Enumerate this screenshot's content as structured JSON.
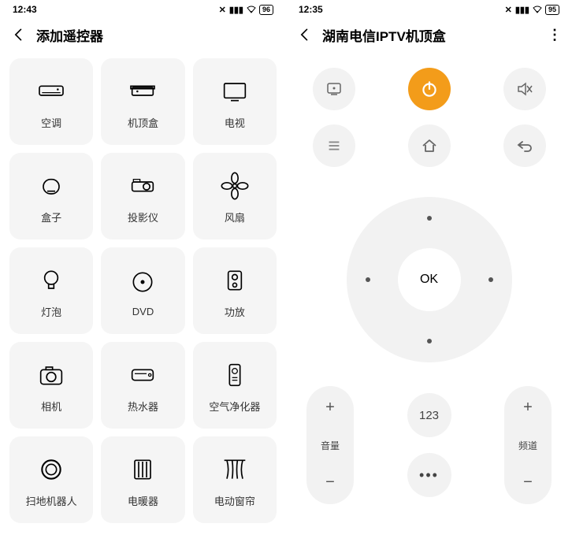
{
  "left": {
    "status_time": "12:43",
    "battery": "96",
    "title": "添加遥控器",
    "cards": [
      {
        "label": "空调",
        "icon": "ac"
      },
      {
        "label": "机顶盒",
        "icon": "stb"
      },
      {
        "label": "电视",
        "icon": "tv"
      },
      {
        "label": "盒子",
        "icon": "box"
      },
      {
        "label": "投影仪",
        "icon": "projector"
      },
      {
        "label": "风扇",
        "icon": "fan"
      },
      {
        "label": "灯泡",
        "icon": "bulb"
      },
      {
        "label": "DVD",
        "icon": "dvd"
      },
      {
        "label": "功放",
        "icon": "amp"
      },
      {
        "label": "相机",
        "icon": "camera"
      },
      {
        "label": "热水器",
        "icon": "heater"
      },
      {
        "label": "空气净化器",
        "icon": "purifier"
      },
      {
        "label": "扫地机器人",
        "icon": "robot"
      },
      {
        "label": "电暖器",
        "icon": "warmer"
      },
      {
        "label": "电动窗帘",
        "icon": "curtain"
      }
    ]
  },
  "right": {
    "status_time": "12:35",
    "battery": "95",
    "title": "湖南电信IPTV机顶盒",
    "ok_label": "OK",
    "numpad_label": "123",
    "volume_label": "音量",
    "channel_label": "频道",
    "plus": "+",
    "minus": "−",
    "more": "•••"
  }
}
